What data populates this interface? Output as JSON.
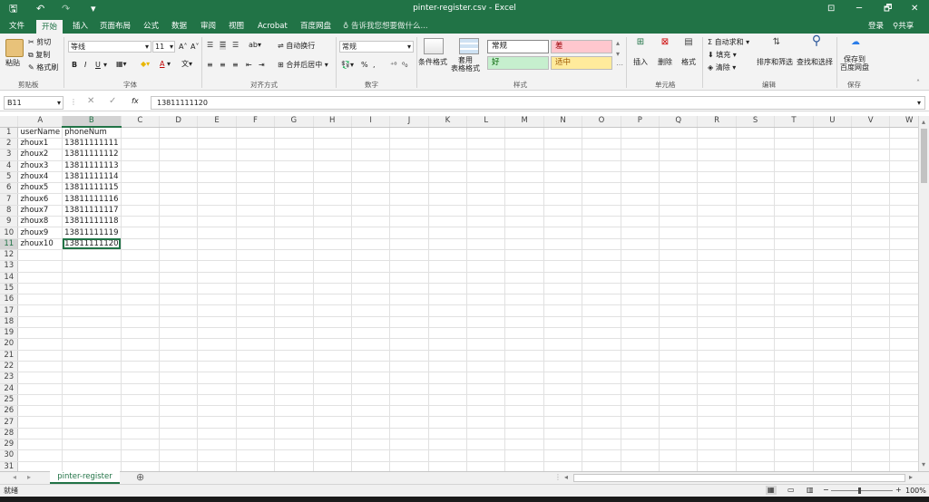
{
  "window": {
    "title": "pinter-register.csv - Excel",
    "minimize": "─",
    "restore": "🗗",
    "close": "✕",
    "ribbon_display": "⊡"
  },
  "quick_access": {
    "save": "🖫",
    "undo": "↶",
    "redo": "↷",
    "customize": "▾"
  },
  "tabs": [
    "文件",
    "开始",
    "插入",
    "页面布局",
    "公式",
    "数据",
    "审阅",
    "视图",
    "Acrobat",
    "百度网盘"
  ],
  "active_tab": "开始",
  "tell_me": "告诉我您想要做什么...",
  "account": {
    "login": "登录",
    "share": "共享"
  },
  "ribbon": {
    "clipboard": {
      "label": "剪贴板",
      "paste": "粘贴",
      "cut": "剪切",
      "copy": "复制",
      "painter": "格式刷"
    },
    "font": {
      "label": "字体",
      "name": "等线",
      "size": "11",
      "grow": "A˄",
      "shrink": "A˅",
      "bold": "B",
      "italic": "I",
      "underline": "U",
      "font_color": "A"
    },
    "alignment": {
      "label": "对齐方式",
      "wrap": "自动换行",
      "merge": "合并后居中"
    },
    "number": {
      "label": "数字",
      "format": "常规",
      "percent": "%",
      "comma": ","
    },
    "styles": {
      "label": "样式",
      "cond_format": "条件格式",
      "table_format": "套用\n表格格式",
      "normal": "常规",
      "bad": "差",
      "good": "好",
      "neutral": "适中"
    },
    "cells": {
      "label": "单元格",
      "insert": "插入",
      "delete": "删除",
      "format": "格式"
    },
    "editing": {
      "label": "编辑",
      "autosum": "自动求和",
      "fill": "填充",
      "clear": "清除",
      "sort": "排序和筛选",
      "find": "查找和选择"
    },
    "save": {
      "label": "保存",
      "save_baidu": "保存到\n百度网盘"
    }
  },
  "formula_bar": {
    "name_box": "B11",
    "fx": "fx",
    "value": "13811111120"
  },
  "columns": [
    "A",
    "B",
    "C",
    "D",
    "E",
    "F",
    "G",
    "H",
    "I",
    "J",
    "K",
    "L",
    "M",
    "N",
    "O",
    "P",
    "Q",
    "R",
    "S",
    "T",
    "U",
    "V",
    "W"
  ],
  "data_rows": [
    [
      "userName",
      "phoneNum"
    ],
    [
      "zhoux1",
      "13811111111"
    ],
    [
      "zhoux2",
      "13811111112"
    ],
    [
      "zhoux3",
      "13811111113"
    ],
    [
      "zhoux4",
      "13811111114"
    ],
    [
      "zhoux5",
      "13811111115"
    ],
    [
      "zhoux6",
      "13811111116"
    ],
    [
      "zhoux7",
      "13811111117"
    ],
    [
      "zhoux8",
      "13811111118"
    ],
    [
      "zhoux9",
      "13811111119"
    ],
    [
      "zhoux10",
      "13811111120"
    ]
  ],
  "row_count": 31,
  "selected": {
    "col": "B",
    "row": 11
  },
  "sheet_tab": "pinter-register",
  "add_sheet": "⊕",
  "status": {
    "ready": "就绪",
    "zoom": "100%"
  },
  "colors": {
    "accent": "#217346",
    "bad_bg": "#ffc7ce",
    "good_bg": "#c6efce",
    "neutral_bg": "#ffeb9c"
  }
}
